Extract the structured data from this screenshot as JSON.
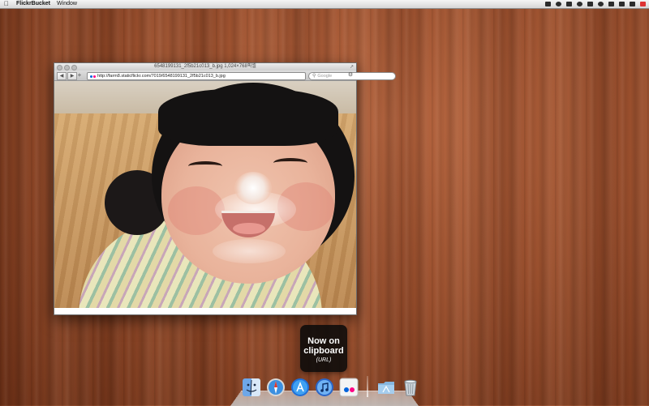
{
  "menubar": {
    "app_name": "FlickrBucket",
    "menus": [
      "Window"
    ],
    "status_icons": [
      "flickrbucket-status-icon",
      "eye-icon",
      "tag-icon",
      "headphones-icon",
      "glasses-icon",
      "wifi-icon",
      "bluetooth-icon",
      "volume-icon",
      "battery-icon",
      "input-flag-icon"
    ]
  },
  "browser": {
    "title": "6548199131_2f5b21c013_b.jpg 1,024×768픽셀",
    "url": "http://farm8.staticflickr.com/7019/6548199131_2f5b21c013_b.jpg",
    "search_placeholder": "Google"
  },
  "notification": {
    "line1": "Now on",
    "line2": "clipboard",
    "line3": "(URL)"
  },
  "dock": {
    "apps": [
      {
        "name": "Finder",
        "icon": "finder-icon"
      },
      {
        "name": "Safari",
        "icon": "safari-icon"
      },
      {
        "name": "App Store",
        "icon": "app-store-icon"
      },
      {
        "name": "iTunes",
        "icon": "itunes-icon"
      },
      {
        "name": "FlickrBucket",
        "icon": "flickr-icon"
      }
    ],
    "stacks": [
      {
        "name": "Applications",
        "icon": "folder-icon"
      },
      {
        "name": "Trash",
        "icon": "trash-icon"
      }
    ]
  },
  "colors": {
    "flickr_pink": "#ff0084",
    "flickr_blue": "#0063dc"
  }
}
